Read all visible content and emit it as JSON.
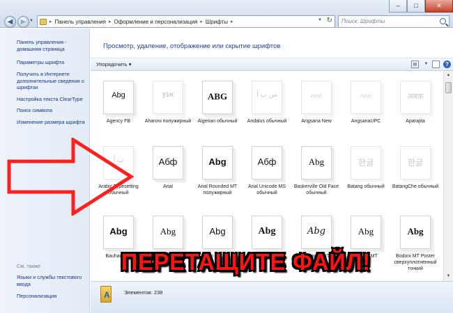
{
  "window": {
    "minimize_glyph": "–",
    "maximize_glyph": "□",
    "close_glyph": "✕"
  },
  "addressbar": {
    "back_glyph": "◀",
    "forward_glyph": "▶",
    "breadcrumbs": [
      "Панель управления",
      "Оформление и персонализация",
      "Шрифты"
    ],
    "separator": "▸",
    "search_placeholder": "Поиск: Шрифты"
  },
  "sidebar": {
    "home": "Панель управления - домашняя страница",
    "links": [
      "Параметры шрифта",
      "Получить в Интернете дополнительные сведения о шрифтах",
      "Настройка текста ClearType",
      "Поиск символа",
      "Изменение размера шрифта"
    ],
    "see_also_title": "См. также",
    "see_also": [
      "Языки и службы текстового ввода",
      "Персонализация"
    ]
  },
  "main": {
    "title": "Просмотр, удаление, отображение или скрытие шрифтов"
  },
  "toolbar": {
    "organize": "Упорядочить",
    "organize_arrow": "▾",
    "help": "?"
  },
  "fonts": [
    {
      "sample": "Abg",
      "label": "Agency FB"
    },
    {
      "sample": "אנץ",
      "label": "Aharoni полужирный"
    },
    {
      "sample": "ABG",
      "label": "Algerian обычный"
    },
    {
      "sample": "ﺱ ﺏ ﺃ",
      "label": "Andalus обычный"
    },
    {
      "sample": "ภฦฦ",
      "label": "Angsana New"
    },
    {
      "sample": "ภฦฦ",
      "label": "AngsanaUPC"
    },
    {
      "sample": "अबक",
      "label": "Aparajita"
    },
    {
      "sample": "ﺏ ﺃ",
      "label": "Arabic Typesetting обычный"
    },
    {
      "sample": "Абф",
      "label": "Arial"
    },
    {
      "sample": "Abg",
      "label": "Arial Rounded MT полужирный"
    },
    {
      "sample": "Абф",
      "label": "Arial Unicode MS обычный"
    },
    {
      "sample": "Abg",
      "label": "Baskerville Old Face обычный"
    },
    {
      "sample": "한글",
      "label": "Batang обычный"
    },
    {
      "sample": "한글",
      "label": "BatangChe обычный"
    },
    {
      "sample": "Abg",
      "label": "Bauhaus 93"
    },
    {
      "sample": "Abg",
      "label": "Bell MT"
    },
    {
      "sample": "Abg",
      "label": "Berlin Sans FB"
    },
    {
      "sample": "Abg",
      "label": "Bernard MT"
    },
    {
      "sample": "Abg",
      "label": "Blackadder ITC"
    },
    {
      "sample": "Abg",
      "label": "Bodoni MT"
    },
    {
      "sample": "Abg",
      "label": "Bodoni MT Poster сверхуплотненный тонкий"
    }
  ],
  "details": {
    "count": "Элементов: 238"
  },
  "overlay": {
    "drag_text": "ПЕРЕТАЩИТЕ ФАЙЛ!"
  },
  "colors": {
    "link": "#15338a",
    "title": "#1a3f9e",
    "overlay_text": "#ff1212",
    "overlay_outline": "#000000"
  }
}
